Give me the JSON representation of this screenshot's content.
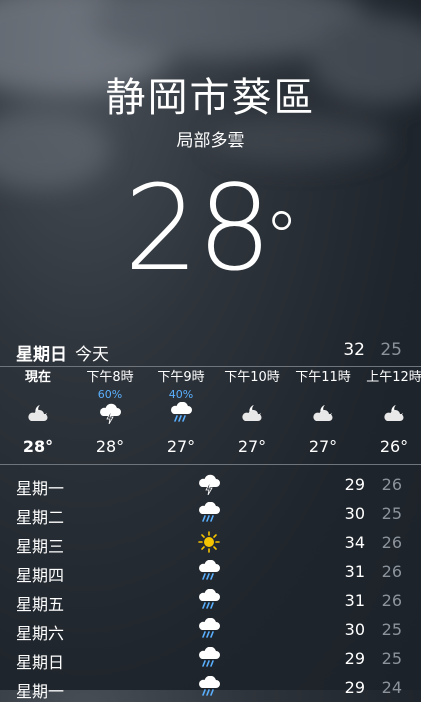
{
  "location": {
    "city": "静岡市葵區",
    "condition": "局部多雲"
  },
  "current": {
    "temperature": "28",
    "degree_symbol": "°"
  },
  "today": {
    "weekday": "星期日",
    "label": "今天",
    "high": "32",
    "low": "25"
  },
  "hourly": [
    {
      "time": "現在",
      "precip": "",
      "icon": "partly-cloudy-night-icon",
      "temp": "28°"
    },
    {
      "time": "下午8時",
      "precip": "60%",
      "icon": "thunderstorm-icon",
      "temp": "28°"
    },
    {
      "time": "下午9時",
      "precip": "40%",
      "icon": "rain-icon",
      "temp": "27°"
    },
    {
      "time": "下午10時",
      "precip": "",
      "icon": "partly-cloudy-night-icon",
      "temp": "27°"
    },
    {
      "time": "下午11時",
      "precip": "",
      "icon": "partly-cloudy-night-icon",
      "temp": "27°"
    },
    {
      "time": "上午12時",
      "precip": "",
      "icon": "partly-cloudy-night-icon",
      "temp": "26°"
    }
  ],
  "daily": [
    {
      "day": "星期一",
      "icon": "thunderstorm-icon",
      "high": "29",
      "low": "26"
    },
    {
      "day": "星期二",
      "icon": "rain-icon",
      "high": "30",
      "low": "25"
    },
    {
      "day": "星期三",
      "icon": "sun-icon",
      "high": "34",
      "low": "26"
    },
    {
      "day": "星期四",
      "icon": "rain-icon",
      "high": "31",
      "low": "26"
    },
    {
      "day": "星期五",
      "icon": "rain-icon",
      "high": "31",
      "low": "26"
    },
    {
      "day": "星期六",
      "icon": "rain-icon",
      "high": "30",
      "low": "25"
    },
    {
      "day": "星期日",
      "icon": "rain-icon",
      "high": "29",
      "low": "25"
    },
    {
      "day": "星期一",
      "icon": "rain-icon",
      "high": "29",
      "low": "24"
    }
  ],
  "colors": {
    "precip": "#5ab0ff",
    "sun": "#f5c400",
    "low_temp": "#8d939a"
  }
}
